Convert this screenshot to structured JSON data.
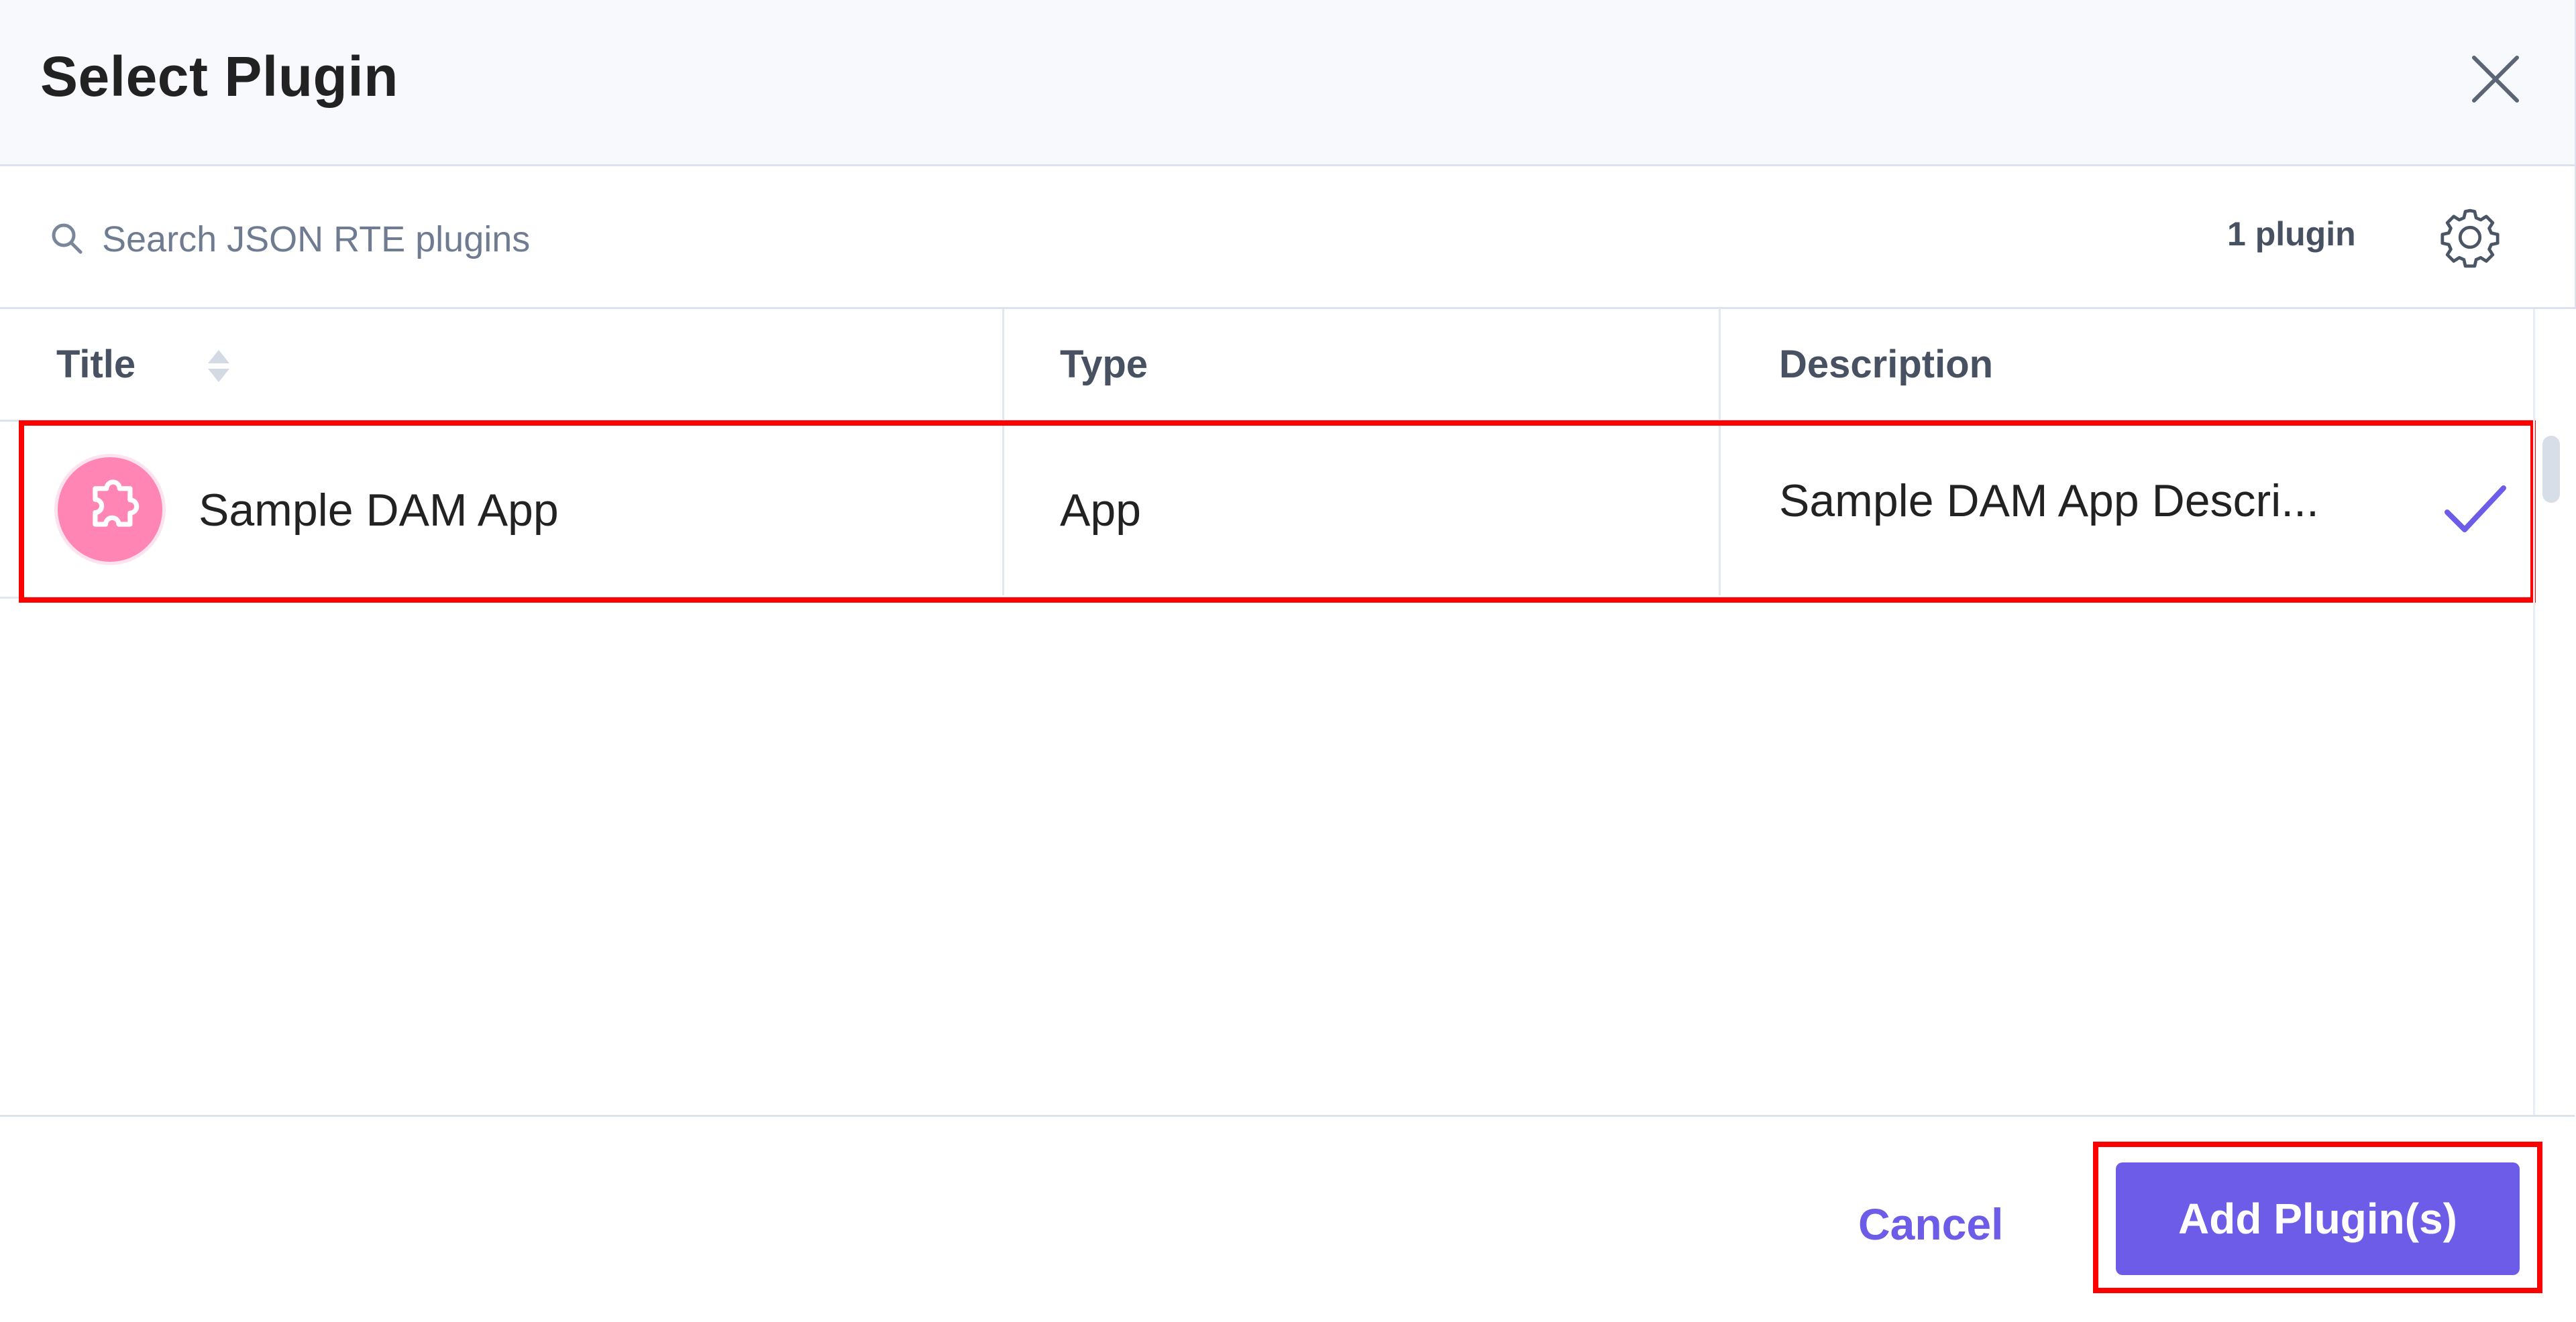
{
  "modal": {
    "title": "Select Plugin"
  },
  "toolbar": {
    "search_placeholder": "Search JSON RTE plugins",
    "search_value": "",
    "count_label": "1 plugin"
  },
  "table": {
    "columns": [
      "Title",
      "Type",
      "Description"
    ],
    "rows": [
      {
        "title": "Sample DAM App",
        "type": "App",
        "description": "Sample DAM App Descri...",
        "selected": true
      }
    ]
  },
  "footer": {
    "cancel_label": "Cancel",
    "add_label": "Add Plugin(s)"
  },
  "colors": {
    "accent": "#6c5ce7",
    "avatar": "#ff85b4",
    "highlight": "#ff0000"
  },
  "icons": [
    "close-icon",
    "search-icon",
    "gear-icon",
    "sort-icon",
    "puzzle-icon",
    "check-icon"
  ]
}
